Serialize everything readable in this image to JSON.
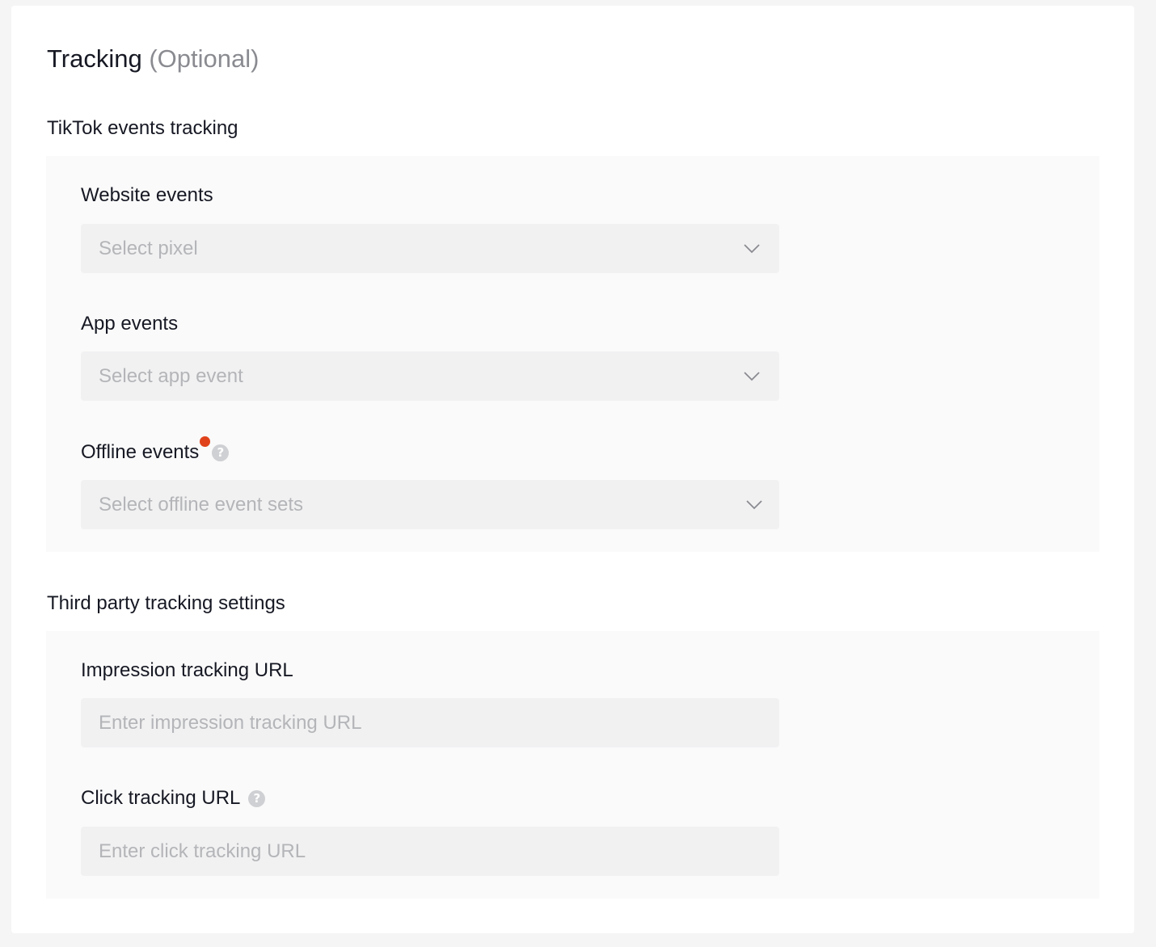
{
  "card": {
    "title": "Tracking",
    "title_suffix": "(Optional)"
  },
  "tiktok_section": {
    "title": "TikTok events tracking",
    "website_events": {
      "label": "Website events",
      "placeholder": "Select pixel",
      "icon": "chevron-down-icon"
    },
    "app_events": {
      "label": "App events",
      "placeholder": "Select app event",
      "icon": "chevron-down-icon"
    },
    "offline_events": {
      "label": "Offline events",
      "placeholder": "Select offline event sets",
      "help_glyph": "?",
      "icon": "chevron-down-icon",
      "has_new_badge": true
    }
  },
  "third_party_section": {
    "title": "Third party tracking settings",
    "impression_url": {
      "label": "Impression tracking URL",
      "placeholder": "Enter impression tracking URL"
    },
    "click_url": {
      "label": "Click tracking URL",
      "placeholder": "Enter click tracking URL",
      "help_glyph": "?"
    }
  },
  "colors": {
    "badge": "#e0431b",
    "field_bg": "#f1f1f2",
    "panel_bg": "#fafafa",
    "placeholder": "#b4b5b8"
  }
}
